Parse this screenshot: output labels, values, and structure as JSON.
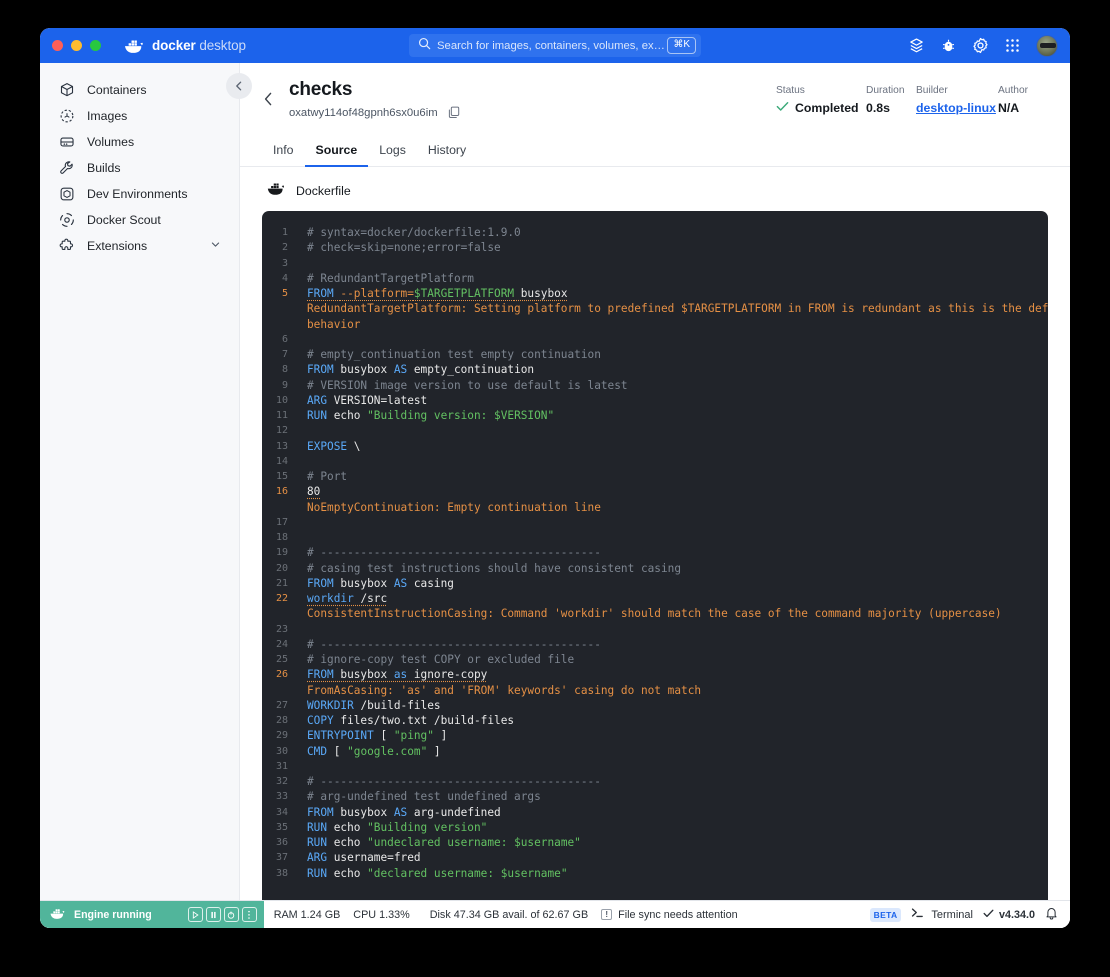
{
  "titlebar": {
    "brand_bold": "docker",
    "brand_light": "desktop",
    "search_placeholder": "Search for images, containers, volumes, extensi…",
    "search_shortcut": "⌘K",
    "icons": [
      "extensions-icon",
      "bug-icon",
      "settings-gear-icon",
      "apps-grid-icon",
      "avatar"
    ],
    "accent": "#1c63eb"
  },
  "sidebar": {
    "items": [
      {
        "label": "Containers",
        "icon": "container-cube-icon"
      },
      {
        "label": "Images",
        "icon": "images-icon"
      },
      {
        "label": "Volumes",
        "icon": "volumes-icon"
      },
      {
        "label": "Builds",
        "icon": "wrench-icon"
      },
      {
        "label": "Dev Environments",
        "icon": "dev-environments-icon"
      },
      {
        "label": "Docker Scout",
        "icon": "docker-scout-icon"
      },
      {
        "label": "Extensions",
        "icon": "extensions-puzzle-icon",
        "chevron": "chevron-down-icon"
      }
    ]
  },
  "header": {
    "build_name": "checks",
    "build_id": "oxatwy114of48gpnh6sx0u6im",
    "meta": [
      {
        "label": "Status",
        "value": "Completed",
        "icon": "check-icon"
      },
      {
        "label": "Duration",
        "value": "0.8s"
      },
      {
        "label": "Builder",
        "value": "desktop-linux",
        "link": true
      },
      {
        "label": "Author",
        "value": "N/A"
      }
    ]
  },
  "tabs": [
    {
      "label": "Info",
      "active": false
    },
    {
      "label": "Source",
      "active": true
    },
    {
      "label": "Logs",
      "active": false
    },
    {
      "label": "History",
      "active": false
    }
  ],
  "file": {
    "name": "Dockerfile",
    "icon": "docker-whale-icon"
  },
  "code_lines": [
    {
      "n": "1",
      "parts": [
        {
          "t": "# syntax=docker/dockerfile:1.9.0",
          "c": "c-com"
        }
      ]
    },
    {
      "n": "2",
      "parts": [
        {
          "t": "# check=skip=none;error=false",
          "c": "c-com"
        }
      ]
    },
    {
      "n": "3",
      "parts": []
    },
    {
      "n": "4",
      "parts": [
        {
          "t": "# RedundantTargetPlatform",
          "c": "c-com"
        }
      ]
    },
    {
      "n": "5",
      "warn": true,
      "underline": true,
      "parts": [
        {
          "t": "FROM",
          "c": "c-kw"
        },
        {
          "t": " ",
          "c": "c-txt"
        },
        {
          "t": "--platform=",
          "c": "c-flag"
        },
        {
          "t": "$TARGETPLATFORM",
          "c": "c-var"
        },
        {
          "t": " busybox",
          "c": "c-txt"
        }
      ],
      "message": "RedundantTargetPlatform: Setting platform to predefined $TARGETPLATFORM in FROM is redundant as this is the default",
      "message2": "behavior"
    },
    {
      "n": "6",
      "parts": []
    },
    {
      "n": "7",
      "parts": [
        {
          "t": "# empty_continuation test empty continuation",
          "c": "c-com"
        }
      ]
    },
    {
      "n": "8",
      "parts": [
        {
          "t": "FROM",
          "c": "c-kw"
        },
        {
          "t": " busybox ",
          "c": "c-txt"
        },
        {
          "t": "AS",
          "c": "c-as"
        },
        {
          "t": " empty_continuation",
          "c": "c-txt"
        }
      ]
    },
    {
      "n": "9",
      "parts": [
        {
          "t": "# VERSION image version to use default is latest",
          "c": "c-com"
        }
      ]
    },
    {
      "n": "10",
      "parts": [
        {
          "t": "ARG",
          "c": "c-kw"
        },
        {
          "t": " VERSION=latest",
          "c": "c-txt"
        }
      ]
    },
    {
      "n": "11",
      "parts": [
        {
          "t": "RUN",
          "c": "c-kw"
        },
        {
          "t": " echo ",
          "c": "c-txt"
        },
        {
          "t": "\"Building version: $VERSION\"",
          "c": "c-str"
        }
      ]
    },
    {
      "n": "12",
      "parts": []
    },
    {
      "n": "13",
      "parts": [
        {
          "t": "EXPOSE",
          "c": "c-kw"
        },
        {
          "t": " \\",
          "c": "c-txt"
        }
      ]
    },
    {
      "n": "14",
      "parts": []
    },
    {
      "n": "15",
      "parts": [
        {
          "t": "# Port",
          "c": "c-com"
        }
      ]
    },
    {
      "n": "16",
      "warn": true,
      "underline": true,
      "parts": [
        {
          "t": "80",
          "c": "c-txt"
        }
      ],
      "message": "NoEmptyContinuation: Empty continuation line"
    },
    {
      "n": "17",
      "parts": []
    },
    {
      "n": "18",
      "parts": []
    },
    {
      "n": "19",
      "parts": [
        {
          "t": "# ------------------------------------------",
          "c": "c-com"
        }
      ]
    },
    {
      "n": "20",
      "parts": [
        {
          "t": "# casing test instructions should have consistent casing",
          "c": "c-com"
        }
      ]
    },
    {
      "n": "21",
      "parts": [
        {
          "t": "FROM",
          "c": "c-kw"
        },
        {
          "t": " busybox ",
          "c": "c-txt"
        },
        {
          "t": "AS",
          "c": "c-as"
        },
        {
          "t": " casing",
          "c": "c-txt"
        }
      ]
    },
    {
      "n": "22",
      "warn": true,
      "underline": true,
      "parts": [
        {
          "t": "workdir",
          "c": "c-kw"
        },
        {
          "t": " /src",
          "c": "c-txt"
        }
      ],
      "message": "ConsistentInstructionCasing: Command 'workdir' should match the case of the command majority (uppercase)"
    },
    {
      "n": "23",
      "parts": []
    },
    {
      "n": "24",
      "parts": [
        {
          "t": "# ------------------------------------------",
          "c": "c-com"
        }
      ]
    },
    {
      "n": "25",
      "parts": [
        {
          "t": "# ignore-copy test COPY or excluded file",
          "c": "c-com"
        }
      ]
    },
    {
      "n": "26",
      "warn": true,
      "underline": true,
      "parts": [
        {
          "t": "FROM",
          "c": "c-kw"
        },
        {
          "t": " busybox ",
          "c": "c-txt"
        },
        {
          "t": "as",
          "c": "c-as"
        },
        {
          "t": " ignore-copy",
          "c": "c-txt"
        }
      ],
      "message": "FromAsCasing: 'as' and 'FROM' keywords' casing do not match"
    },
    {
      "n": "27",
      "parts": [
        {
          "t": "WORKDIR",
          "c": "c-kw"
        },
        {
          "t": " /build-files",
          "c": "c-txt"
        }
      ]
    },
    {
      "n": "28",
      "parts": [
        {
          "t": "COPY",
          "c": "c-kw"
        },
        {
          "t": " files/two.txt /build-files",
          "c": "c-txt"
        }
      ]
    },
    {
      "n": "29",
      "parts": [
        {
          "t": "ENTRYPOINT",
          "c": "c-kw"
        },
        {
          "t": " [ ",
          "c": "c-txt"
        },
        {
          "t": "\"ping\"",
          "c": "c-str"
        },
        {
          "t": " ]",
          "c": "c-txt"
        }
      ]
    },
    {
      "n": "30",
      "parts": [
        {
          "t": "CMD",
          "c": "c-kw"
        },
        {
          "t": " [ ",
          "c": "c-txt"
        },
        {
          "t": "\"google.com\"",
          "c": "c-str"
        },
        {
          "t": " ]",
          "c": "c-txt"
        }
      ]
    },
    {
      "n": "31",
      "parts": []
    },
    {
      "n": "32",
      "parts": [
        {
          "t": "# ------------------------------------------",
          "c": "c-com"
        }
      ]
    },
    {
      "n": "33",
      "parts": [
        {
          "t": "# arg-undefined test undefined args",
          "c": "c-com"
        }
      ]
    },
    {
      "n": "34",
      "parts": [
        {
          "t": "FROM",
          "c": "c-kw"
        },
        {
          "t": " busybox ",
          "c": "c-txt"
        },
        {
          "t": "AS",
          "c": "c-as"
        },
        {
          "t": " arg-undefined",
          "c": "c-txt"
        }
      ]
    },
    {
      "n": "35",
      "parts": [
        {
          "t": "RUN",
          "c": "c-kw"
        },
        {
          "t": " echo ",
          "c": "c-txt"
        },
        {
          "t": "\"Building version\"",
          "c": "c-str"
        }
      ]
    },
    {
      "n": "36",
      "parts": [
        {
          "t": "RUN",
          "c": "c-kw"
        },
        {
          "t": " echo ",
          "c": "c-txt"
        },
        {
          "t": "\"undeclared username: $username\"",
          "c": "c-str"
        }
      ]
    },
    {
      "n": "37",
      "parts": [
        {
          "t": "ARG",
          "c": "c-kw"
        },
        {
          "t": " username=fred",
          "c": "c-txt"
        }
      ]
    },
    {
      "n": "38",
      "parts": [
        {
          "t": "RUN",
          "c": "c-kw"
        },
        {
          "t": " echo ",
          "c": "c-txt"
        },
        {
          "t": "\"declared username: $username\"",
          "c": "c-str"
        }
      ]
    }
  ],
  "statusbar": {
    "engine_label": "Engine running",
    "engine_color": "#51b59b",
    "ram": "RAM 1.24 GB",
    "cpu": "CPU 1.33%",
    "disk": "Disk 47.34 GB avail. of 62.67 GB",
    "file_sync": "File sync needs attention",
    "beta": "BETA",
    "terminal": "Terminal",
    "version": "v4.34.0"
  }
}
